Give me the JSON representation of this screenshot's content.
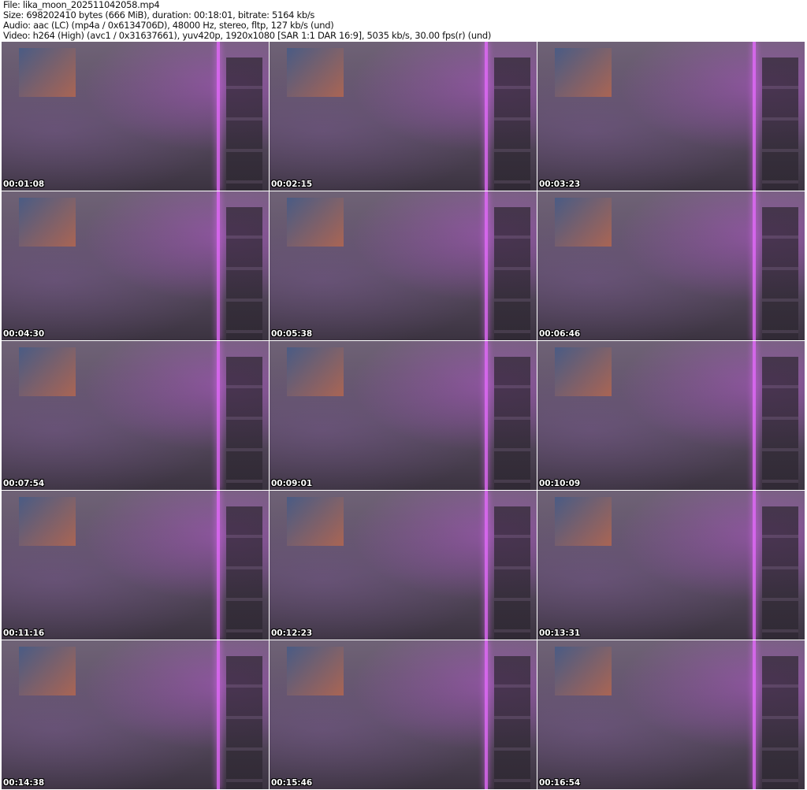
{
  "header": {
    "file": "File: lika_moon_202511042058.mp4",
    "size": "Size: 698202410 bytes (666 MiB), duration: 00:18:01, bitrate: 5164 kb/s",
    "audio": "Audio: aac (LC) (mp4a / 0x6134706D), 48000 Hz, stereo, fltp, 127 kb/s (und)",
    "video": "Video: h264 (High) (avc1 / 0x31637661), yuv420p, 1920x1080 [SAR 1:1 DAR 16:9], 5035 kb/s, 30.00 fps(r) (und)"
  },
  "thumbnails": [
    {
      "timestamp": "00:01:08"
    },
    {
      "timestamp": "00:02:15"
    },
    {
      "timestamp": "00:03:23"
    },
    {
      "timestamp": "00:04:30"
    },
    {
      "timestamp": "00:05:38"
    },
    {
      "timestamp": "00:06:46"
    },
    {
      "timestamp": "00:07:54"
    },
    {
      "timestamp": "00:09:01"
    },
    {
      "timestamp": "00:10:09"
    },
    {
      "timestamp": "00:11:16"
    },
    {
      "timestamp": "00:12:23"
    },
    {
      "timestamp": "00:13:31"
    },
    {
      "timestamp": "00:14:38"
    },
    {
      "timestamp": "00:15:46"
    },
    {
      "timestamp": "00:16:54"
    }
  ]
}
